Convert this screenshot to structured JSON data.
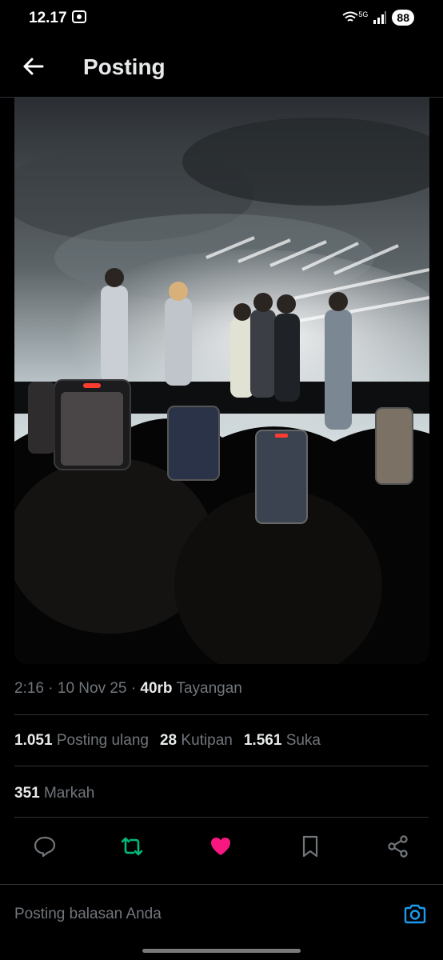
{
  "status": {
    "time": "12.17",
    "battery": "88",
    "network": "5G"
  },
  "header": {
    "title": "Posting"
  },
  "tweet": {
    "time": "2:16",
    "date": "10 Nov 25",
    "views": "40rb",
    "views_label": "Tayangan",
    "reposts": "1.051",
    "reposts_label": "Posting ulang",
    "quotes": "28",
    "quotes_label": "Kutipan",
    "likes": "1.561",
    "likes_label": "Suka",
    "bookmarks": "351",
    "bookmarks_label": "Markah"
  },
  "actions": {
    "icons": [
      "reply-icon",
      "repost-icon",
      "like-icon",
      "bookmark-icon",
      "share-icon"
    ],
    "repost_color": "#00ba7c",
    "like_color": "#f91880"
  },
  "reply": {
    "placeholder": "Posting balasan Anda"
  },
  "colors": {
    "accent": "#1d9bf0",
    "text": "#e7e9ea",
    "muted": "#71767b",
    "background": "#000000"
  }
}
